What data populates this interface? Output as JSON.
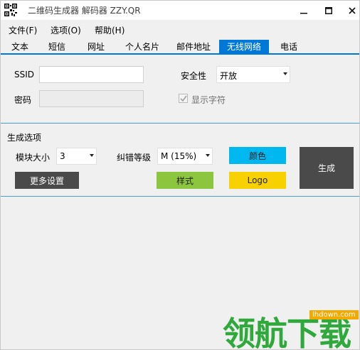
{
  "window": {
    "title": "二维码生成器 解码器 ZZY.QR",
    "icon": "qr-code-icon",
    "controls": {
      "minimize": "—",
      "maximize": "□",
      "close": "✕"
    }
  },
  "menu": [
    "文件(F)",
    "选项(O)",
    "帮助(H)"
  ],
  "tabs": [
    "文本",
    "短信",
    "网址",
    "个人名片",
    "邮件地址",
    "无线网络",
    "电话"
  ],
  "active_tab": "无线网络",
  "wifi": {
    "ssid_label": "SSID",
    "ssid_value": "",
    "password_label": "密码",
    "password_value": "",
    "security_label": "安全性",
    "security_value": "开放",
    "show_chars_label": "显示字符",
    "show_chars_checked": true
  },
  "generate_options": {
    "section_label": "生成选项",
    "module_size_label": "模块大小",
    "module_size_value": "3",
    "ecc_label": "纠错等级",
    "ecc_value": "M (15%)",
    "color_button": "颜色",
    "generate_button": "生成",
    "more_settings_button": "更多设置",
    "style_button": "样式",
    "logo_button": "Logo"
  },
  "watermark": {
    "site": "lhdown.com",
    "brand": "领航下载"
  },
  "colors": {
    "accent": "#0078d7",
    "color_button": "#00b8f0",
    "style_button": "#8cc63f",
    "logo_button": "#f8d100",
    "dark_button": "#4a4a4a",
    "watermark_green": "#2fa83c"
  }
}
